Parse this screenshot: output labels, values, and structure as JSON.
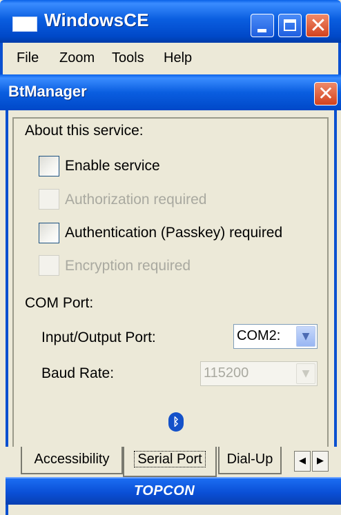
{
  "window": {
    "title": "WindowsCE",
    "close_glyph": "✕"
  },
  "menu": {
    "items": [
      "File",
      "Zoom",
      "Tools",
      "Help"
    ]
  },
  "dialog": {
    "title": "BtManager",
    "close_glyph": "✕"
  },
  "service": {
    "heading": "About this service:",
    "options": [
      {
        "label": "Enable service",
        "enabled": true,
        "checked": false
      },
      {
        "label": "Authorization required",
        "enabled": false,
        "checked": false
      },
      {
        "label": "Authentication (Passkey) required",
        "enabled": true,
        "checked": false
      },
      {
        "label": "Encryption required",
        "enabled": false,
        "checked": false
      }
    ]
  },
  "com_port": {
    "heading": "COM Port:",
    "io_port_label": "Input/Output Port:",
    "io_port_value": "COM2:",
    "baud_label": "Baud Rate:",
    "baud_value": "115200"
  },
  "tabs": [
    {
      "label": "Accessibility",
      "active": false
    },
    {
      "label": "Serial Port",
      "active": true
    },
    {
      "label": "Dial-Up",
      "active": false
    }
  ],
  "tab_scroll": {
    "left": "◀",
    "right": "▶"
  },
  "footer": {
    "brand": "TOPCON"
  },
  "colors": {
    "titlebar": "#0a5ee0",
    "close_button": "#d2421e",
    "panel_bg": "#ece9d8",
    "bluetooth": "#1451c9"
  },
  "icons": {
    "app": "window-icon",
    "bluetooth": "bluetooth-icon",
    "dropdown": "chevron-down-icon"
  }
}
